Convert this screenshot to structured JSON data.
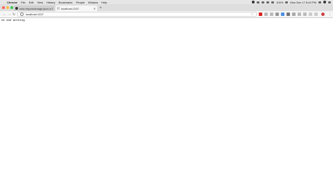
{
  "menubar": {
    "app": "Chrome",
    "items": [
      "File",
      "Edit",
      "View",
      "History",
      "Bookmarks",
      "People",
      "Window",
      "Help"
    ],
    "battery": "100%",
    "clock": "Mon Dec 17  8:43 PM"
  },
  "tabs": [
    {
      "title": "new-rmprotoimage.json at m…",
      "favicon": "github-icon"
    },
    {
      "title": "localhost:1337",
      "favicon": "page-icon"
    }
  ],
  "toolbar": {
    "url": "localhost:1337"
  },
  "page": {
    "text": "ok and working"
  },
  "colors": {
    "close": "#fc605b",
    "minimize": "#fdbc40",
    "maximize": "#34c84a"
  }
}
